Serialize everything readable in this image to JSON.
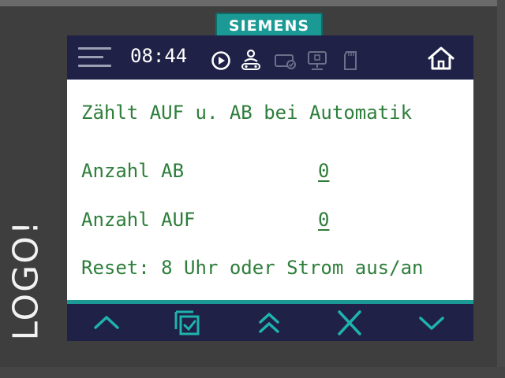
{
  "device": {
    "brand": "SIEMENS",
    "model": "LOGO!"
  },
  "status_bar": {
    "time": "08:44",
    "icons": [
      "menu-icon",
      "run-icon",
      "user-network-icon",
      "display-icon",
      "computer-icon",
      "sd-card-icon",
      "home-icon"
    ]
  },
  "screen": {
    "line1": "Zählt AUF u. AB bei Automatik",
    "counter_down_label": "Anzahl AB",
    "counter_down_value": "0",
    "counter_up_label": "Anzahl AUF",
    "counter_up_value": "0",
    "reset_note": "Reset: 8 Uhr oder Strom aus/an"
  },
  "nav": {
    "buttons": [
      "chevron-up-icon",
      "select-icon",
      "double-chevron-up-icon",
      "close-icon",
      "chevron-down-icon"
    ]
  },
  "colors": {
    "bar_bg": "#1f2147",
    "accent": "#1b9a95",
    "text_green": "#2d7e3a",
    "body": "#3e3e3e"
  }
}
